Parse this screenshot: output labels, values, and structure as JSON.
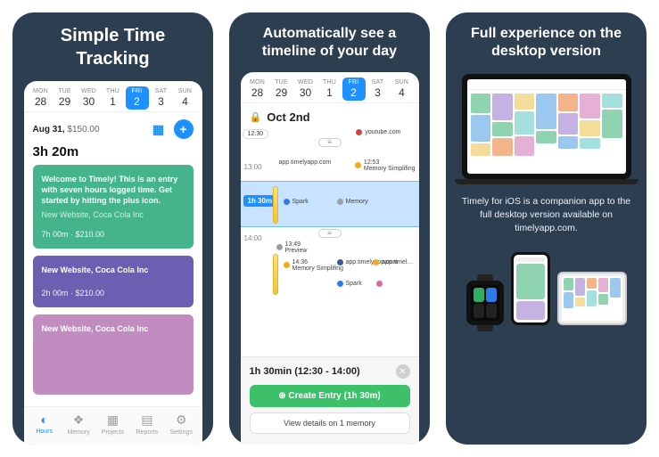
{
  "panels": {
    "p1_title": "Simple Time\nTracking",
    "p2_title": "Automatically see a\ntimeline of your day",
    "p3_title": "Full experience on the\ndesktop version"
  },
  "date_strip": [
    {
      "dow": "MON",
      "num": "28",
      "selected": false
    },
    {
      "dow": "TUE",
      "num": "29",
      "selected": false
    },
    {
      "dow": "WED",
      "num": "30",
      "selected": false
    },
    {
      "dow": "THU",
      "num": "1",
      "selected": false
    },
    {
      "dow": "FRI",
      "num": "2",
      "selected": true
    },
    {
      "dow": "SAT",
      "num": "3",
      "selected": false
    },
    {
      "dow": "SUN",
      "num": "4",
      "selected": false
    }
  ],
  "p1": {
    "summary_date": "Aug 31,",
    "summary_amount": "$150.00",
    "summary_total": "3h 20m",
    "cards": [
      {
        "title": "Welcome to Timely! This is an entry with seven hours logged time. Get started by hitting the plus icon.",
        "sub": "New Website, Coca Cola Inc",
        "meta": "7h 00m · $210.00"
      },
      {
        "title": "New Website, Coca Cola Inc",
        "sub": "",
        "meta": "2h 00m · $210.00"
      },
      {
        "title": "New Website, Coca Cola Inc",
        "sub": "",
        "meta": ""
      }
    ],
    "tabs": [
      "Hours",
      "Memory",
      "Projects",
      "Reports",
      "Settings"
    ]
  },
  "p2": {
    "heading": "Oct 2nd",
    "selected_duration": "1h 30m",
    "labels": {
      "t1230": "12:30",
      "t1300": "13:00",
      "t1400": "14:00",
      "youtube": "youtube.com",
      "apptimely": "app.timelyapp.com",
      "spark": "Spark",
      "memory": "Memory",
      "t1253": "12:53",
      "memsimp": "Memory Simplifing",
      "t1349": "13:49",
      "preview": "Preview",
      "t1436": "14:36",
      "apptime2": "app.timel…"
    },
    "footer": {
      "summary": "1h 30min (12:30 - 14:00)",
      "create": "Create Entry (1h 30m)",
      "view": "View details on 1 memory"
    }
  },
  "p3": {
    "desc": "Timely for iOS is a companion app to the full desktop version available on timelyapp.com."
  }
}
